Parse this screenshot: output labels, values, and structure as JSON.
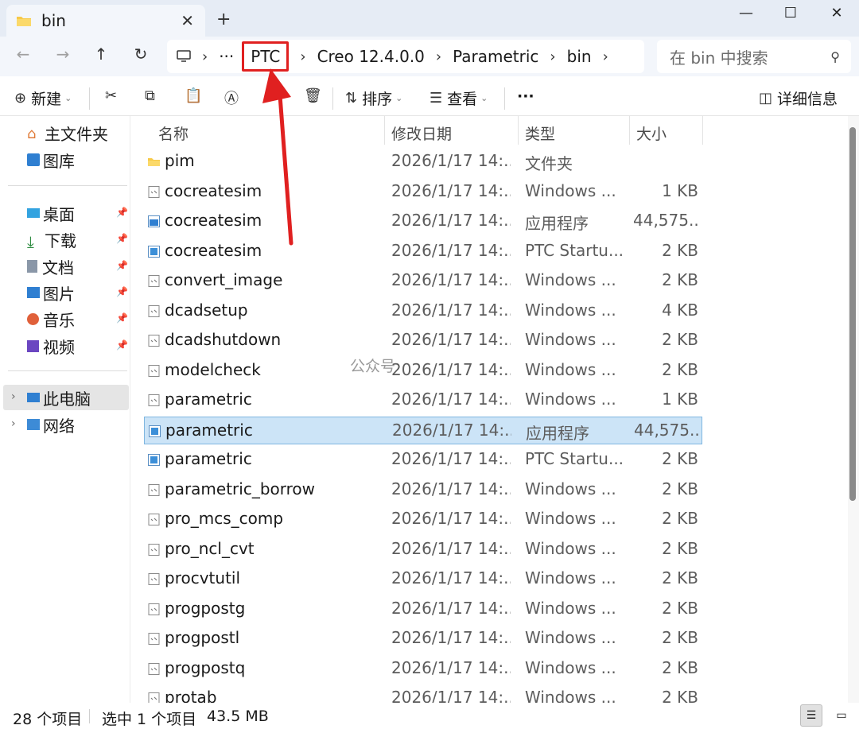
{
  "tab": {
    "title": "bin",
    "close": "✕",
    "new": "+"
  },
  "window": {
    "minimize": "—",
    "maximize": "☐",
    "close": "✕"
  },
  "nav": {
    "back": "←",
    "forward": "→",
    "up": "↑",
    "refresh": "↻"
  },
  "breadcrumb": {
    "more": "···",
    "items": [
      "PTC",
      "Creo 12.4.0.0",
      "Parametric",
      "bin"
    ],
    "separator": "›"
  },
  "search": {
    "placeholder": "在 bin 中搜索"
  },
  "toolbar": {
    "new_label": "新建",
    "sort_label": "排序",
    "view_label": "查看",
    "more_label": "···",
    "details_label": "详细信息"
  },
  "sidebar": {
    "quick": [
      {
        "label": "主文件夹",
        "icon": "home-icon"
      },
      {
        "label": "图库",
        "icon": "gallery-icon"
      }
    ],
    "pinned": [
      {
        "label": "桌面",
        "icon": "desktop-icon"
      },
      {
        "label": "下载",
        "icon": "download-icon"
      },
      {
        "label": "文档",
        "icon": "document-icon"
      },
      {
        "label": "图片",
        "icon": "pictures-icon"
      },
      {
        "label": "音乐",
        "icon": "music-icon"
      },
      {
        "label": "视频",
        "icon": "video-icon"
      }
    ],
    "locations": [
      {
        "label": "此电脑",
        "icon": "this-pc-icon"
      },
      {
        "label": "网络",
        "icon": "network-icon"
      }
    ],
    "pin_glyph": "📌"
  },
  "columns": {
    "name": "名称",
    "date": "修改日期",
    "type": "类型",
    "size": "大小"
  },
  "files": [
    {
      "name": "pim",
      "date": "2026/1/17 14:...",
      "type": "文件夹",
      "size": "",
      "kind": "folder"
    },
    {
      "name": "cocreatesim",
      "date": "2026/1/17 14:...",
      "type": "Windows ...",
      "size": "1 KB",
      "kind": "script"
    },
    {
      "name": "cocreatesim",
      "date": "2026/1/17 14:...",
      "type": "应用程序",
      "size": "44,575...",
      "kind": "exe"
    },
    {
      "name": "cocreatesim",
      "date": "2026/1/17 14:...",
      "type": "PTC Startu...",
      "size": "2 KB",
      "kind": "ptc"
    },
    {
      "name": "convert_image",
      "date": "2026/1/17 14:...",
      "type": "Windows ...",
      "size": "2 KB",
      "kind": "script"
    },
    {
      "name": "dcadsetup",
      "date": "2026/1/17 14:...",
      "type": "Windows ...",
      "size": "4 KB",
      "kind": "script"
    },
    {
      "name": "dcadshutdown",
      "date": "2026/1/17 14:...",
      "type": "Windows ...",
      "size": "2 KB",
      "kind": "script"
    },
    {
      "name": "modelcheck",
      "date": "2026/1/17 14:...",
      "type": "Windows ...",
      "size": "2 KB",
      "kind": "script"
    },
    {
      "name": "parametric",
      "date": "2026/1/17 14:...",
      "type": "Windows ...",
      "size": "1 KB",
      "kind": "script"
    },
    {
      "name": "parametric",
      "date": "2026/1/17 14:...",
      "type": "应用程序",
      "size": "44,575...",
      "kind": "ptc",
      "selected": true
    },
    {
      "name": "parametric",
      "date": "2026/1/17 14:...",
      "type": "PTC Startu...",
      "size": "2 KB",
      "kind": "ptc"
    },
    {
      "name": "parametric_borrow",
      "date": "2026/1/17 14:...",
      "type": "Windows ...",
      "size": "2 KB",
      "kind": "script"
    },
    {
      "name": "pro_mcs_comp",
      "date": "2026/1/17 14:...",
      "type": "Windows ...",
      "size": "2 KB",
      "kind": "script"
    },
    {
      "name": "pro_ncl_cvt",
      "date": "2026/1/17 14:...",
      "type": "Windows ...",
      "size": "2 KB",
      "kind": "script"
    },
    {
      "name": "procvtutil",
      "date": "2026/1/17 14:...",
      "type": "Windows ...",
      "size": "2 KB",
      "kind": "script"
    },
    {
      "name": "progpostg",
      "date": "2026/1/17 14:...",
      "type": "Windows ...",
      "size": "2 KB",
      "kind": "script"
    },
    {
      "name": "progpostl",
      "date": "2026/1/17 14:...",
      "type": "Windows ...",
      "size": "2 KB",
      "kind": "script"
    },
    {
      "name": "progpostq",
      "date": "2026/1/17 14:...",
      "type": "Windows ...",
      "size": "2 KB",
      "kind": "script"
    },
    {
      "name": "protab",
      "date": "2026/1/17 14:...",
      "type": "Windows ...",
      "size": "2 KB",
      "kind": "script"
    }
  ],
  "watermark": "公众号",
  "status": {
    "count": "28 个项目",
    "selected": "选中 1 个项目",
    "size": "43.5 MB"
  },
  "colors": {
    "selection": "#cce4f7",
    "annotation": "#e02020",
    "accent": "#0067c0"
  }
}
